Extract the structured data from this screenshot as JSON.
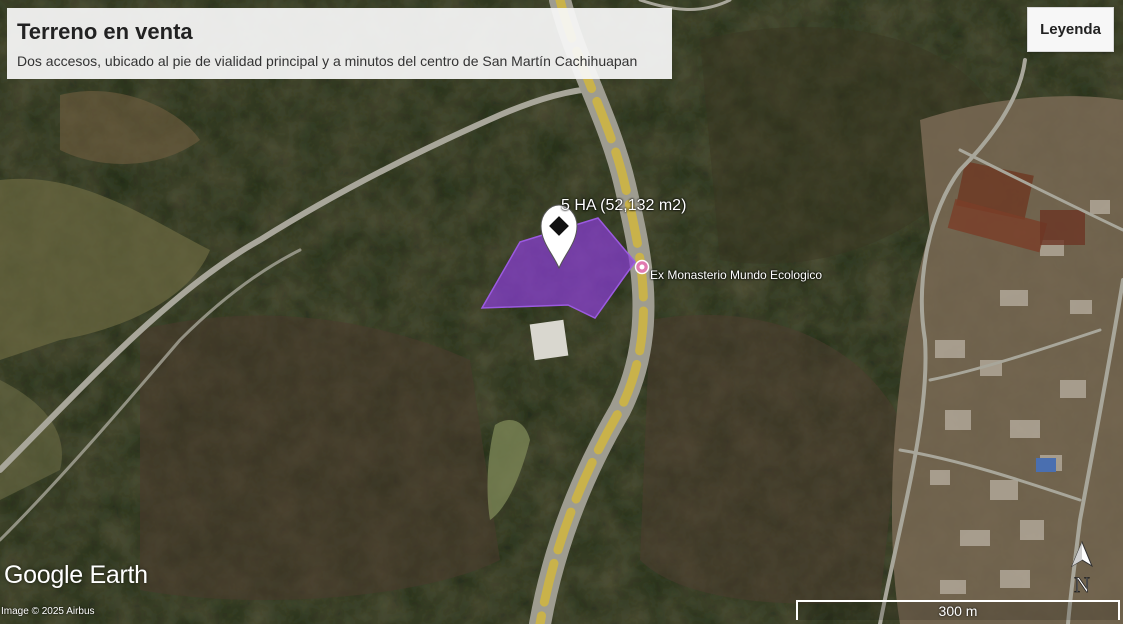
{
  "header": {
    "title": "Terreno en venta",
    "subtitle": "Dos accesos, ubicado al pie de vialidad principal y a minutos del centro de San Martín Cachihuapan"
  },
  "legend_button": {
    "label": "Leyenda"
  },
  "polygon": {
    "label": "5 HA (52,132 m2)",
    "fill_color": "#8a3fd6"
  },
  "poi": {
    "label": "Ex Monasterio Mundo Ecologico",
    "icon": "pink-circle-pin-icon",
    "color": "#e07ab0"
  },
  "placemark": {
    "icon": "map-pin-icon"
  },
  "road_color": "#c9b24a",
  "brand": {
    "name": "Google Earth"
  },
  "credit": "Image © 2025 Airbus",
  "scale": {
    "label": "300 m"
  },
  "north_arrow": {
    "label": "N"
  }
}
